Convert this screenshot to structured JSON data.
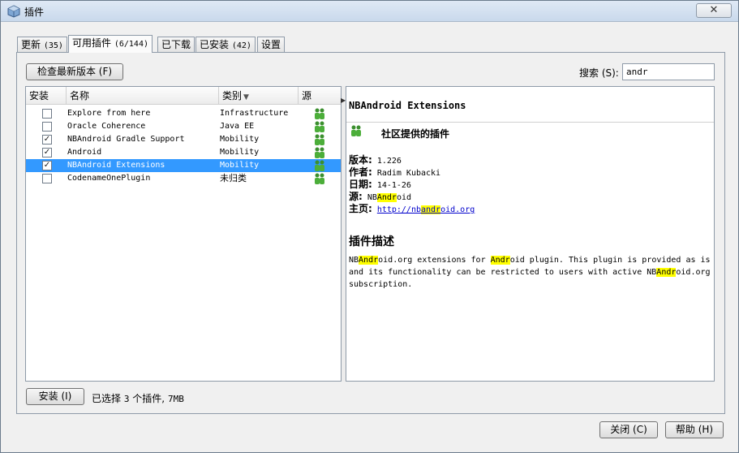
{
  "window": {
    "title": "插件",
    "close_symbol": "✕"
  },
  "tabs": [
    {
      "label": "更新",
      "count": "(35)"
    },
    {
      "label": "可用插件",
      "count": "(6/144)"
    },
    {
      "label": "已下载",
      "count": ""
    },
    {
      "label": "已安装",
      "count": "(42)"
    },
    {
      "label": "设置",
      "count": ""
    }
  ],
  "toolbar": {
    "check_updates_label": "检查最新版本 (F)"
  },
  "search": {
    "label": "搜索 (S):",
    "value": "andr"
  },
  "table": {
    "headers": {
      "install": "安装",
      "name": "名称",
      "category": "类别",
      "source": "源"
    },
    "rows": [
      {
        "checked": false,
        "name": "Explore from here",
        "category": "Infrastructure",
        "source_icon": "community-icon"
      },
      {
        "checked": false,
        "name": "Oracle Coherence",
        "category": "Java EE",
        "source_icon": "community-icon"
      },
      {
        "checked": true,
        "name": "NBAndroid Gradle Support",
        "category": "Mobility",
        "source_icon": "community-icon"
      },
      {
        "checked": true,
        "name": "Android",
        "category": "Mobility",
        "source_icon": "community-icon"
      },
      {
        "checked": true,
        "name": "NBAndroid Extensions",
        "category": "Mobility",
        "source_icon": "community-icon",
        "selected": true
      },
      {
        "checked": false,
        "name": "CodenameOnePlugin",
        "category": "未归类",
        "source_icon": "community-icon"
      }
    ]
  },
  "detail": {
    "title": "NBAndroid Extensions",
    "community_label": "社区提供的插件",
    "version_label": "版本:",
    "version": "1.226",
    "author_label": "作者:",
    "author": "Radim Kubacki",
    "date_label": "日期:",
    "date": "14-1-26",
    "source_label": "源:",
    "source_pre": "NB",
    "source_hl": "Andr",
    "source_post": "oid",
    "homepage_label": "主页:",
    "homepage_pre": "http://nb",
    "homepage_hl": "andr",
    "homepage_post": "oid.org",
    "desc_title": "插件描述",
    "desc_parts": [
      "NB",
      "Andr",
      "oid.org extensions for ",
      "Andr",
      "oid plugin. This plugin is provided as is and its functionality can be restricted to users with active NB",
      "Andr",
      "oid.org subscription."
    ]
  },
  "footer": {
    "install_label": "安装 (I)",
    "status_prefix": "已选择",
    "status_count": "3",
    "status_mid": "个插件,",
    "status_size": "7MB",
    "close_label": "关闭 (C)",
    "help_label": "帮助 (H)"
  },
  "colors": {
    "selection": "#3399ff",
    "highlight": "#ffff00",
    "link": "#0000cc"
  }
}
